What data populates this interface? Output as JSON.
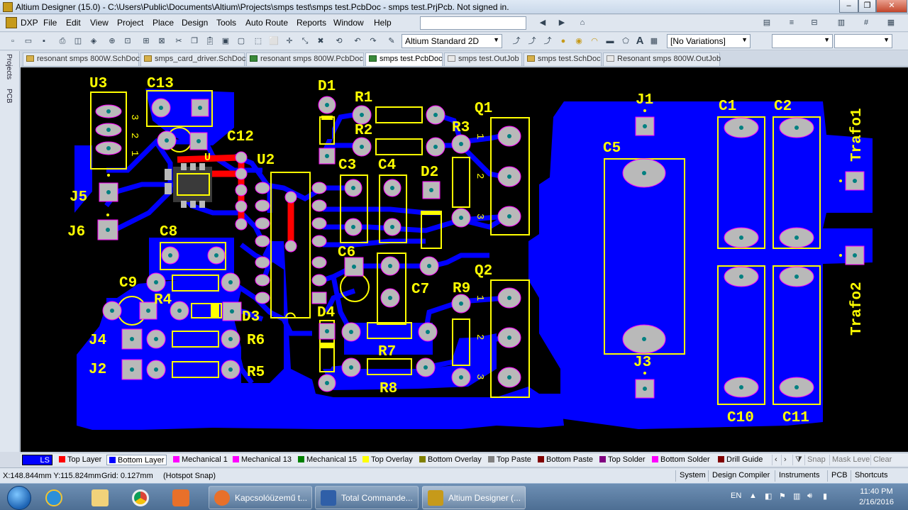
{
  "window": {
    "title": "Altium Designer (15.0) - C:\\Users\\Public\\Documents\\Altium\\Projects\\smps test\\smps test.PcbDoc - smps test.PrjPcb. Not signed in.",
    "minimize": "–",
    "maximize": "❐",
    "close": "✕"
  },
  "menu": [
    "DXP",
    "File",
    "Edit",
    "View",
    "Project",
    "Place",
    "Design",
    "Tools",
    "Auto Route",
    "Reports",
    "Window",
    "Help"
  ],
  "toolbar": {
    "view_mode": "Altium Standard 2D",
    "variations": "[No Variations]"
  },
  "doc_tabs": [
    {
      "label": "resonant smps 800W.SchDoc",
      "kind": "sch"
    },
    {
      "label": "smps_card_driver.SchDoc",
      "kind": "sch"
    },
    {
      "label": "resonant smps 800W.PcbDoc",
      "kind": "pcb"
    },
    {
      "label": "smps test.PcbDoc",
      "kind": "pcb",
      "active": true
    },
    {
      "label": "smps test.OutJob",
      "kind": "job"
    },
    {
      "label": "smps test.SchDoc",
      "kind": "sch"
    },
    {
      "label": "Resonant smps 800W.OutJob",
      "kind": "job"
    }
  ],
  "side_panels": [
    "Projects",
    "PCB"
  ],
  "pcb": {
    "designators": {
      "U3": "U3",
      "C13": "C13",
      "D1": "D1",
      "R1": "R1",
      "Q1": "Q1",
      "R2": "R2",
      "R3": "R3",
      "J1": "J1",
      "C1": "C1",
      "C2": "C2",
      "Trafo1": "Trafo1",
      "C12": "C12",
      "U2": "U2",
      "C3": "C3",
      "C4": "C4",
      "D2": "D2",
      "C5": "C5",
      "J5": "J5",
      "J6": "J6",
      "C8": "C8",
      "C6": "C6",
      "C7": "C7",
      "Q2": "Q2",
      "R9": "R9",
      "Trafo2": "Trafo2",
      "C9": "C9",
      "R4": "R4",
      "D3": "D3",
      "D4": "D4",
      "J4": "J4",
      "R6": "R6",
      "R7": "R7",
      "J2": "J2",
      "R5": "R5",
      "R8": "R8",
      "J3": "J3",
      "C10": "C10",
      "C11": "C11"
    },
    "pin_numbers": {
      "one": "1",
      "two": "2",
      "three": "3"
    },
    "u_marker": "U"
  },
  "layers": [
    {
      "label": "LS",
      "color": "#0000ff"
    },
    {
      "label": "Top Layer",
      "color": "#ff0000"
    },
    {
      "label": "Bottom Layer",
      "color": "#0000ff",
      "active": true
    },
    {
      "label": "Mechanical 1",
      "color": "#ff00ff"
    },
    {
      "label": "Mechanical 13",
      "color": "#ff00ff"
    },
    {
      "label": "Mechanical 15",
      "color": "#008000"
    },
    {
      "label": "Top Overlay",
      "color": "#ffff00"
    },
    {
      "label": "Bottom Overlay",
      "color": "#808000"
    },
    {
      "label": "Top Paste",
      "color": "#808080"
    },
    {
      "label": "Bottom Paste",
      "color": "#800000"
    },
    {
      "label": "Top Solder",
      "color": "#800080"
    },
    {
      "label": "Bottom Solder",
      "color": "#ff00ff"
    },
    {
      "label": "Drill Guide",
      "color": "#800000"
    }
  ],
  "layer_controls": {
    "snap": "Snap",
    "mask_level": "Mask Level",
    "clear": "Clear"
  },
  "status": {
    "coords": "X:148.844mm Y:115.824mm",
    "grid": "Grid: 0.127mm",
    "snap": "(Hotspot Snap)"
  },
  "status_buttons": [
    "System",
    "Design Compiler",
    "Instruments",
    "PCB",
    "Shortcuts"
  ],
  "taskbar": {
    "tasks": [
      {
        "label": "Kapcsolóüzemű t...",
        "color": "#e8702a"
      },
      {
        "label": "Total Commande...",
        "color": "#2f5fa8"
      },
      {
        "label": "Altium Designer (...",
        "color": "#c69a1a",
        "active": true
      }
    ],
    "lang": "EN",
    "time": "11:40 PM",
    "date": "2/16/2016"
  },
  "colors": {
    "bottom_copper": "#0000ff",
    "top_copper": "#ff0000",
    "overlay": "#ffff00",
    "pad": "#b9b9b9",
    "canvas": "#000000"
  }
}
